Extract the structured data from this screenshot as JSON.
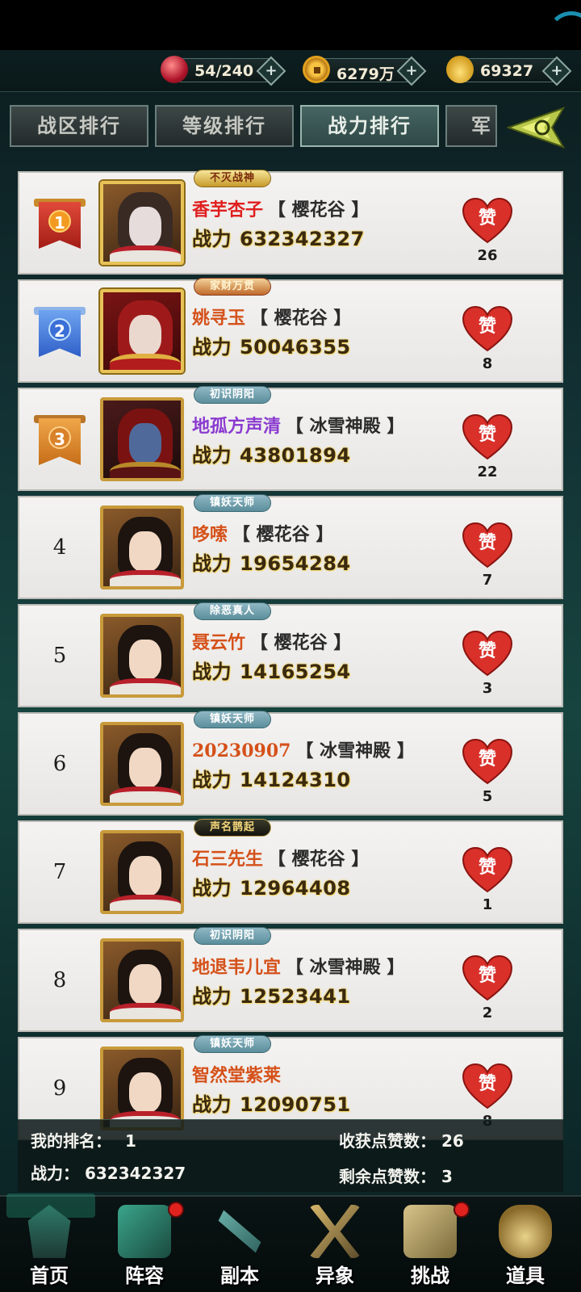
{
  "resources": {
    "stamina": "54/240",
    "silver": "6279万",
    "gold": "69327"
  },
  "tabs": [
    "战区排行",
    "等级排行",
    "战力排行",
    "军"
  ],
  "power_label": "战力",
  "like_label": "赞",
  "rows": [
    {
      "rank": "1",
      "title": "不灭战神",
      "name": "香芋杏子",
      "server": "【 樱花谷 】",
      "power": "632342327",
      "likes": "26"
    },
    {
      "rank": "2",
      "title": "家财万贯",
      "name": "姚寻玉",
      "server": "【 樱花谷 】",
      "power": "50046355",
      "likes": "8"
    },
    {
      "rank": "3",
      "title": "初识阴阳",
      "name": "地孤方声清",
      "server": "【 冰雪神殿 】",
      "power": "43801894",
      "likes": "22"
    },
    {
      "rank": "4",
      "title": "镇妖天师",
      "name": "哆嗦",
      "server": "【 樱花谷 】",
      "power": "19654284",
      "likes": "7"
    },
    {
      "rank": "5",
      "title": "除恶真人",
      "name": "聂云竹",
      "server": "【 樱花谷 】",
      "power": "14165254",
      "likes": "3"
    },
    {
      "rank": "6",
      "title": "镇妖天师",
      "name": "20230907",
      "server": "【 冰雪神殿 】",
      "power": "14124310",
      "likes": "5"
    },
    {
      "rank": "7",
      "title": "声名鹊起",
      "name": "石三先生",
      "server": "【 樱花谷 】",
      "power": "12964408",
      "likes": "1"
    },
    {
      "rank": "8",
      "title": "初识阴阳",
      "name": "地退韦儿宜",
      "server": "【 冰雪神殿 】",
      "power": "12523441",
      "likes": "2"
    },
    {
      "rank": "9",
      "title": "镇妖天师",
      "name": "智然堂紫莱",
      "server": "",
      "power": "12090751",
      "likes": "8"
    }
  ],
  "my_rank": {
    "rank_label": "我的排名：",
    "rank_value": "1",
    "power_label": "战力：",
    "power_value": "632342327",
    "received_label": "收获点赞数：",
    "received_value": "26",
    "remaining_label": "剩余点赞数：",
    "remaining_value": "3"
  },
  "nav": [
    "首页",
    "阵容",
    "副本",
    "异象",
    "挑战",
    "道具"
  ],
  "colors": {
    "accent": "#e01f1f",
    "name": "#d5511a",
    "heart": "#d9302a"
  }
}
